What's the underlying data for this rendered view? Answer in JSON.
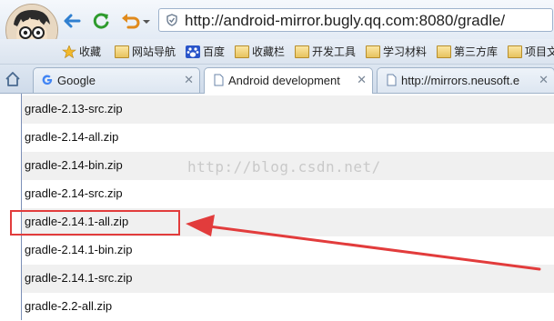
{
  "browser": {
    "url": "http://android-mirror.bugly.qq.com:8080/gradle/",
    "bookmarks": [
      "收藏",
      "网站导航",
      "百度",
      "收藏栏",
      "开发工具",
      "学习材料",
      "第三方库",
      "项目文"
    ],
    "tabs": [
      {
        "label": "Google",
        "icon": "google-g-icon"
      },
      {
        "label": "Android development",
        "icon": "page-icon"
      },
      {
        "label": "http://mirrors.neusoft.e",
        "icon": "page-icon"
      }
    ],
    "colors": {
      "accent": "#2f7fd0",
      "refresh": "#2e9b2e",
      "undo": "#e08a1c",
      "highlight": "#e23c3c"
    }
  },
  "files": [
    "gradle-2.13-src.zip",
    "gradle-2.14-all.zip",
    "gradle-2.14-bin.zip",
    "gradle-2.14-src.zip",
    "gradle-2.14.1-all.zip",
    "gradle-2.14.1-bin.zip",
    "gradle-2.14.1-src.zip",
    "gradle-2.2-all.zip"
  ],
  "highlighted_file": "gradle-2.14.1-all.zip",
  "watermark": "http://blog.csdn.net/"
}
